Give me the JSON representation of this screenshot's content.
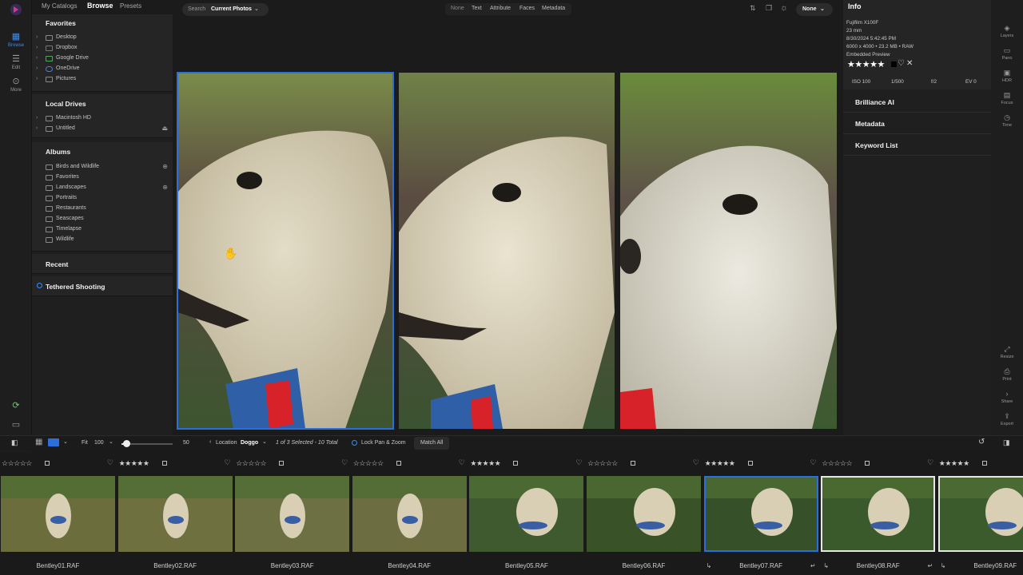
{
  "top_nav": {
    "catalogs": "My Catalogs",
    "browse": "Browse",
    "presets": "Presets"
  },
  "rail": {
    "browse": "Browse",
    "edit": "Edit",
    "more": "More"
  },
  "favorites": {
    "title": "Favorites",
    "items": [
      "Desktop",
      "Dropbox",
      "Google Drive",
      "OneDrive",
      "Pictures"
    ]
  },
  "local_drives": {
    "title": "Local Drives",
    "items": [
      "Macintosh HD",
      "Untitled"
    ]
  },
  "albums": {
    "title": "Albums",
    "items": [
      "Birds and Wildlife",
      "Favorites",
      "Landscapes",
      "Portraits",
      "Restaurants",
      "Seascapes",
      "Timelapse",
      "Wildlife"
    ]
  },
  "recent": {
    "title": "Recent"
  },
  "tethered": {
    "title": "Tethered Shooting"
  },
  "search": {
    "label": "Search",
    "scope": "Current Photos"
  },
  "filters": [
    "None",
    "Text",
    "Attribute",
    "Faces",
    "Metadata"
  ],
  "sort_dropdown": "None",
  "info": {
    "title": "Info",
    "camera": "Fujifilm X100F",
    "focal": "23 mm",
    "date": "8/30/2024 5:42:45 PM",
    "dims": "6000 x 4000 • 23.2 MB • RAW",
    "preview": "Embedded Preview",
    "rating": "★★★★★",
    "iso": "ISO 100",
    "shutter": "1/500",
    "aperture": "f/2",
    "ev": "EV 0"
  },
  "right_sections": [
    "Brilliance AI",
    "Metadata",
    "Keyword List"
  ],
  "right_rail": [
    "Layers",
    "Pano",
    "HDR",
    "Focus",
    "Time",
    "Resize",
    "Print",
    "Share",
    "Export"
  ],
  "bottom_bar": {
    "fit": "Fit",
    "zoom": "100",
    "thumb_size": "50",
    "location_label": "Location",
    "location_value": "Doggo",
    "selection": "1 of 3 Selected - 10 Total",
    "lock": "Lock Pan & Zoom",
    "match": "Match All"
  },
  "filmstrip": [
    {
      "name": "Bentley01.RAF",
      "stars": "☆☆☆☆☆",
      "tone": "#6b6e3c"
    },
    {
      "name": "Bentley02.RAF",
      "stars": "★★★★★",
      "tone": "#6e7040"
    },
    {
      "name": "Bentley03.RAF",
      "stars": "☆☆☆☆☆",
      "tone": "#6d7042"
    },
    {
      "name": "Bentley04.RAF",
      "stars": "☆☆☆☆☆",
      "tone": "#6c6e42"
    },
    {
      "name": "Bentley05.RAF",
      "stars": "★★★★★",
      "tone": "#3f5a2e"
    },
    {
      "name": "Bentley06.RAF",
      "stars": "☆☆☆☆☆",
      "tone": "#3a5228"
    },
    {
      "name": "Bentley07.RAF",
      "stars": "★★★★★",
      "tone": "#36502a"
    },
    {
      "name": "Bentley08.RAF",
      "stars": "☆☆☆☆☆",
      "tone": "#3b5a2c"
    },
    {
      "name": "Bentley09.RAF",
      "stars": "★★★★★",
      "tone": "#3c5b2d"
    }
  ]
}
